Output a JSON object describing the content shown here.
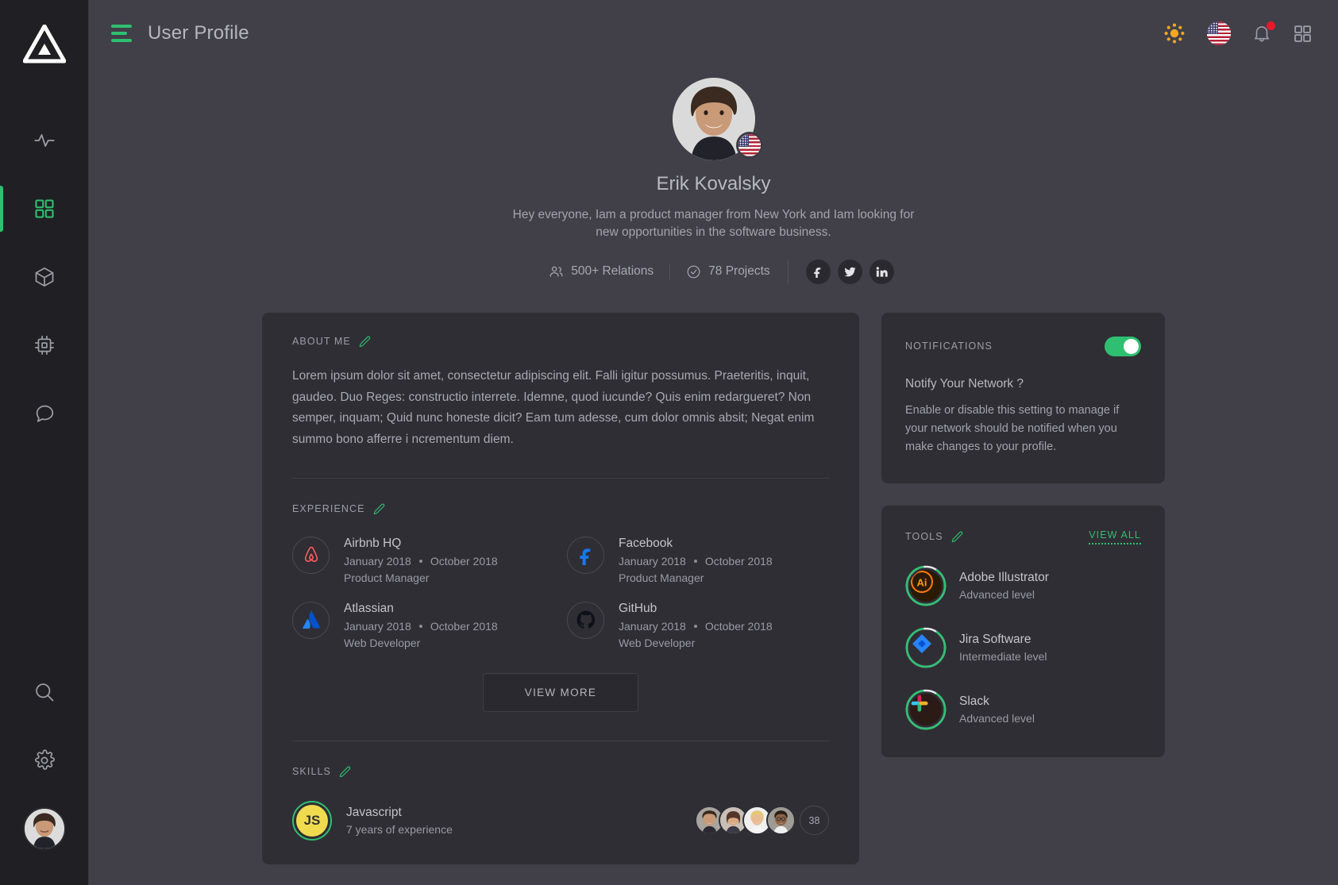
{
  "brand": {
    "logo_icon": "triangle-logo"
  },
  "colors": {
    "accent_green": "#2fbf71",
    "page_bg": "#414048",
    "card_bg": "#2f2e35",
    "sidebar_bg": "#202024",
    "notification_dot": "#e8192c",
    "javascript_yellow": "#f0db4f"
  },
  "sidebar": {
    "top_items": [
      {
        "name": "activity",
        "icon": "activity-pulse-icon",
        "active": false
      },
      {
        "name": "dashboard",
        "icon": "grid-icon",
        "active": true
      },
      {
        "name": "packages",
        "icon": "cube-icon",
        "active": false
      },
      {
        "name": "devices",
        "icon": "cpu-chip-icon",
        "active": false
      },
      {
        "name": "messages",
        "icon": "chat-bubble-icon",
        "active": false
      }
    ],
    "bottom_items": [
      {
        "name": "search",
        "icon": "search-icon"
      },
      {
        "name": "settings",
        "icon": "gear-icon"
      },
      {
        "name": "account",
        "icon": "user-avatar"
      }
    ]
  },
  "header": {
    "menu_icon": "hamburger-menu-icon",
    "title": "User Profile",
    "actions": [
      {
        "name": "theme",
        "icon": "sun-icon"
      },
      {
        "name": "language",
        "icon": "us-flag-icon"
      },
      {
        "name": "notifications",
        "icon": "bell-icon",
        "has_badge": true
      },
      {
        "name": "apps",
        "icon": "apps-grid-icon"
      }
    ]
  },
  "profile": {
    "avatar_icon": "profile-avatar",
    "country_flag": "us-flag-icon",
    "name": "Erik Kovalsky",
    "bio": "Hey everyone,  Iam a product manager from New York and Iam looking for new opportunities in the software business.",
    "stats": [
      {
        "icon": "users-icon",
        "label": "500+ Relations"
      },
      {
        "icon": "check-circle-icon",
        "label": "78 Projects"
      }
    ],
    "socials": [
      {
        "name": "facebook",
        "icon": "facebook-icon"
      },
      {
        "name": "twitter",
        "icon": "twitter-icon"
      },
      {
        "name": "linkedin",
        "icon": "linkedin-icon"
      }
    ]
  },
  "about": {
    "label": "ABOUT ME",
    "edit_icon": "pencil-icon",
    "text": "Lorem ipsum dolor sit amet, consectetur adipiscing elit. Falli igitur possumus. Praeteritis, inquit, gaudeo. Duo Reges: constructio interrete. Idemne, quod iucunde? Quis enim redargueret? Non semper, inquam; Quid nunc honeste dicit? Eam tum adesse, cum dolor omnis absit; Negat enim summo bono afferre i ncrementum diem."
  },
  "experience": {
    "label": "EXPERIENCE",
    "edit_icon": "pencil-icon",
    "items": [
      {
        "company": "Airbnb HQ",
        "start": "January 2018",
        "end": "October 2018",
        "role": "Product Manager",
        "logo": "airbnb-logo"
      },
      {
        "company": "Facebook",
        "start": "January 2018",
        "end": "October 2018",
        "role": "Product Manager",
        "logo": "facebook-logo"
      },
      {
        "company": "Atlassian",
        "start": "January 2018",
        "end": "October 2018",
        "role": "Web Developer",
        "logo": "atlassian-logo"
      },
      {
        "company": "GitHub",
        "start": "January 2018",
        "end": "October 2018",
        "role": "Web Developer",
        "logo": "github-logo"
      }
    ],
    "view_more_label": "VIEW MORE"
  },
  "skills": {
    "label": "SKILLS",
    "edit_icon": "pencil-icon",
    "items": [
      {
        "badge_text": "JS",
        "name": "Javascript",
        "experience": "7 years of experience",
        "endorser_count": "38",
        "endorsers": 4
      }
    ]
  },
  "notifications_card": {
    "label": "NOTIFICATIONS",
    "toggle_on": true,
    "title": "Notify Your Network ?",
    "description": "Enable or disable this setting to manage if your network should be notified when you make changes to your profile."
  },
  "tools_card": {
    "label": "TOOLS",
    "edit_icon": "pencil-icon",
    "view_all_label": "VIEW ALL",
    "items": [
      {
        "name": "Adobe Illustrator",
        "level": "Advanced level",
        "icon": "adobe-illustrator-logo",
        "progress": 88
      },
      {
        "name": "Jira Software",
        "level": "Intermediate level",
        "icon": "jira-logo",
        "progress": 88
      },
      {
        "name": "Slack",
        "level": "Advanced level",
        "icon": "slack-logo",
        "progress": 88
      }
    ]
  }
}
